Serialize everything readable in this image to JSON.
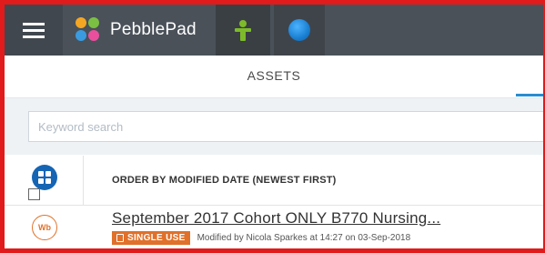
{
  "topbar": {
    "brand_name": "PebblePad",
    "brand_colors": [
      "#f5a623",
      "#7bc043",
      "#3b9be0",
      "#e94f9d"
    ],
    "menu_icon": "hamburger-icon",
    "tabs": [
      {
        "icon": "person-icon",
        "color": "#7dbb2a"
      },
      {
        "icon": "globe-icon",
        "color": "#1a7fd1"
      }
    ]
  },
  "assets": {
    "title": "ASSETS"
  },
  "search": {
    "placeholder": "Keyword search",
    "value": ""
  },
  "order": {
    "label": "ORDER BY MODIFIED DATE (NEWEST FIRST)",
    "view_icon": "grid-view-icon"
  },
  "asset_list": [
    {
      "badge": "Wb",
      "title": "September 2017 Cohort ONLY  B770  Nursing...",
      "tag": "SINGLE USE",
      "modified": "Modified by Nicola Sparkes at 14:27 on 03-Sep-2018"
    }
  ]
}
